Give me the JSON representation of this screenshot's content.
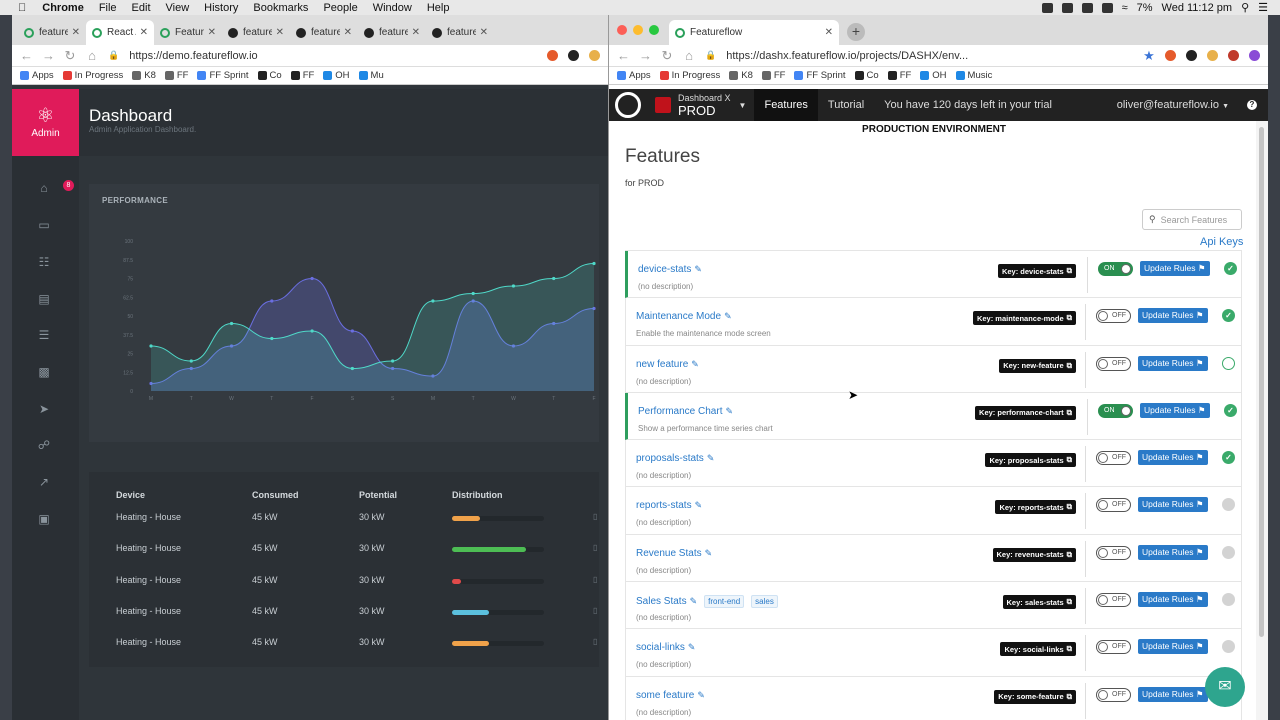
{
  "menubar": {
    "app": "Chrome",
    "items": [
      "File",
      "Edit",
      "View",
      "History",
      "Bookmarks",
      "People",
      "Window",
      "Help"
    ],
    "battery": "7%",
    "datetime": "Wed 11:12 pm",
    "music": "Music"
  },
  "left_browser": {
    "tabs": [
      {
        "title": "featurefl",
        "active": false
      },
      {
        "title": "React Ap",
        "active": true
      },
      {
        "title": "Featuref",
        "active": false
      },
      {
        "title": "featurefl",
        "active": false
      },
      {
        "title": "featurefl",
        "active": false
      },
      {
        "title": "featurefl",
        "active": false
      },
      {
        "title": "featurefl",
        "active": false
      }
    ],
    "url": "https://demo.featureflow.io",
    "bookmarks": [
      "Apps",
      "In Progress",
      "K8",
      "FF",
      "FF Sprint",
      "Co",
      "FF",
      "OH",
      "Mu"
    ],
    "app": {
      "brand_label": "Admin",
      "title": "Dashboard",
      "subtitle": "Admin Application Dashboard.",
      "side_badge": "8",
      "chart_title": "PERFORMANCE",
      "chart_data": {
        "type": "area",
        "x": [
          "M",
          "T",
          "W",
          "T",
          "F",
          "S",
          "S",
          "M",
          "T",
          "W",
          "T",
          "F"
        ],
        "y_ticks": [
          "0",
          "12.5",
          "25",
          "37.5",
          "50",
          "62.5",
          "75",
          "87.5",
          "100"
        ],
        "series": [
          {
            "values": [
              5,
              15,
              30,
              60,
              75,
              40,
              15,
              10,
              60,
              30,
              45,
              55
            ]
          },
          {
            "values": [
              30,
              20,
              45,
              35,
              40,
              15,
              20,
              60,
              65,
              70,
              75,
              85
            ]
          }
        ]
      },
      "table": {
        "headers": [
          "Device",
          "Consumed",
          "Potential",
          "Distribution"
        ],
        "rows": [
          {
            "device": "Heating - House",
            "consumed": "45 kW",
            "potential": "30 kW",
            "dist": 0.3,
            "color": "#f0a24a"
          },
          {
            "device": "Heating - House",
            "consumed": "45 kW",
            "potential": "30 kW",
            "dist": 0.8,
            "color": "#4dbd54"
          },
          {
            "device": "Heating - House",
            "consumed": "45 kW",
            "potential": "30 kW",
            "dist": 0.1,
            "color": "#e04a4a"
          },
          {
            "device": "Heating - House",
            "consumed": "45 kW",
            "potential": "30 kW",
            "dist": 0.4,
            "color": "#5bc0de"
          },
          {
            "device": "Heating - House",
            "consumed": "45 kW",
            "potential": "30 kW",
            "dist": 0.4,
            "color": "#f0a24a"
          }
        ]
      }
    }
  },
  "right_browser": {
    "tab_title": "Featureflow",
    "url": "https://dashx.featureflow.io/projects/DASHX/env...",
    "bookmarks": [
      "Apps",
      "In Progress",
      "K8",
      "FF",
      "FF Sprint",
      "Co",
      "FF",
      "OH",
      "Music"
    ],
    "nav": {
      "project": "Dashboard X",
      "env": "PROD",
      "features": "Features",
      "tutorial": "Tutorial",
      "trial": "You have 120 days left in your trial",
      "user": "oliver@featureflow.io"
    },
    "env_heading": "PRODUCTION ENVIRONMENT",
    "page_title": "Features",
    "page_sub": "for PROD",
    "search_placeholder": "Search Features",
    "api_keys": "Api Keys",
    "update_rules": "Update Rules",
    "features": [
      {
        "name": "device-stats",
        "desc": "(no description)",
        "key": "Key: device-stats",
        "on": true,
        "status": "ok",
        "tags": []
      },
      {
        "name": "Maintenance Mode",
        "desc": "Enable the maintenance mode screen",
        "key": "Key: maintenance-mode",
        "on": false,
        "status": "ok",
        "tags": []
      },
      {
        "name": "new feature",
        "desc": "(no description)",
        "key": "Key: new-feature",
        "on": false,
        "status": "empty",
        "tags": []
      },
      {
        "name": "Performance Chart",
        "desc": "Show a performance time series chart",
        "key": "Key: performance-chart",
        "on": true,
        "status": "ok",
        "tags": []
      },
      {
        "name": "proposals-stats",
        "desc": "(no description)",
        "key": "Key: proposals-stats",
        "on": false,
        "status": "ok",
        "tags": []
      },
      {
        "name": "reports-stats",
        "desc": "(no description)",
        "key": "Key: reports-stats",
        "on": false,
        "status": "grey",
        "tags": []
      },
      {
        "name": "Revenue Stats",
        "desc": "(no description)",
        "key": "Key: revenue-stats",
        "on": false,
        "status": "grey",
        "tags": []
      },
      {
        "name": "Sales Stats",
        "desc": "(no description)",
        "key": "Key: sales-stats",
        "on": false,
        "status": "grey",
        "tags": [
          "front-end",
          "sales"
        ]
      },
      {
        "name": "social-links",
        "desc": "(no description)",
        "key": "Key: social-links",
        "on": false,
        "status": "grey",
        "tags": []
      },
      {
        "name": "some feature",
        "desc": "(no description)",
        "key": "Key: some-feature",
        "on": false,
        "status": "grey",
        "tags": []
      }
    ],
    "toggle_on": "ON",
    "toggle_off": "OFF"
  }
}
